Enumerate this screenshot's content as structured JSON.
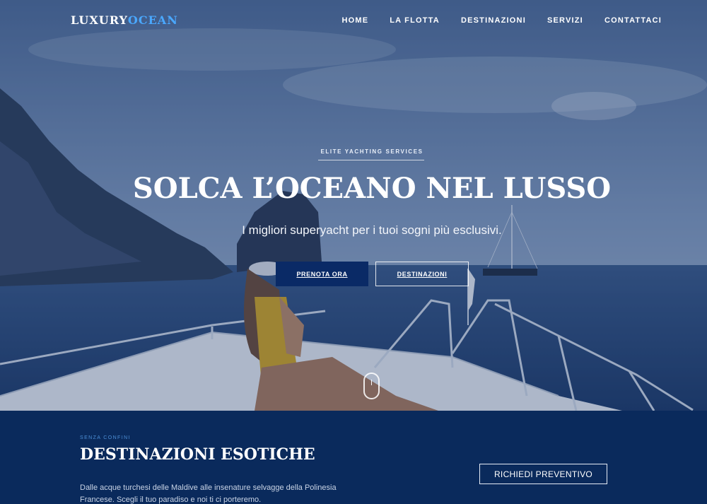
{
  "brand": {
    "part1": "LUXURY",
    "part2": "OCEAN"
  },
  "nav": {
    "items": [
      "HOME",
      "LA FLOTTA",
      "DESTINAZIONI",
      "SERVIZI",
      "CONTATTACI"
    ]
  },
  "hero": {
    "eyebrow": "ELITE YACHTING SERVICES",
    "title": "SOLCA L’OCEANO NEL LUSSO",
    "subtitle": "I migliori superyacht per i tuoi sogni più esclusivi.",
    "primary_button": "PRENOTA ORA",
    "secondary_button": "DESTINAZIONI"
  },
  "section": {
    "eyebrow": "SENZA CONFINI",
    "title": "DESTINAZIONI ESOTICHE",
    "text": "Dalle acque turchesi delle Maldive alle insenature selvagge della Polinesia Francese. Scegli il tuo paradiso e noi ti ci porteremo.",
    "quote_button": "RICHIEDI PREVENTIVO"
  },
  "colors": {
    "accent": "#4aa8ff",
    "navy": "#0a2a5c",
    "button": "#0a2a66"
  },
  "icons": {
    "scroll": "mouse-scroll-icon"
  }
}
